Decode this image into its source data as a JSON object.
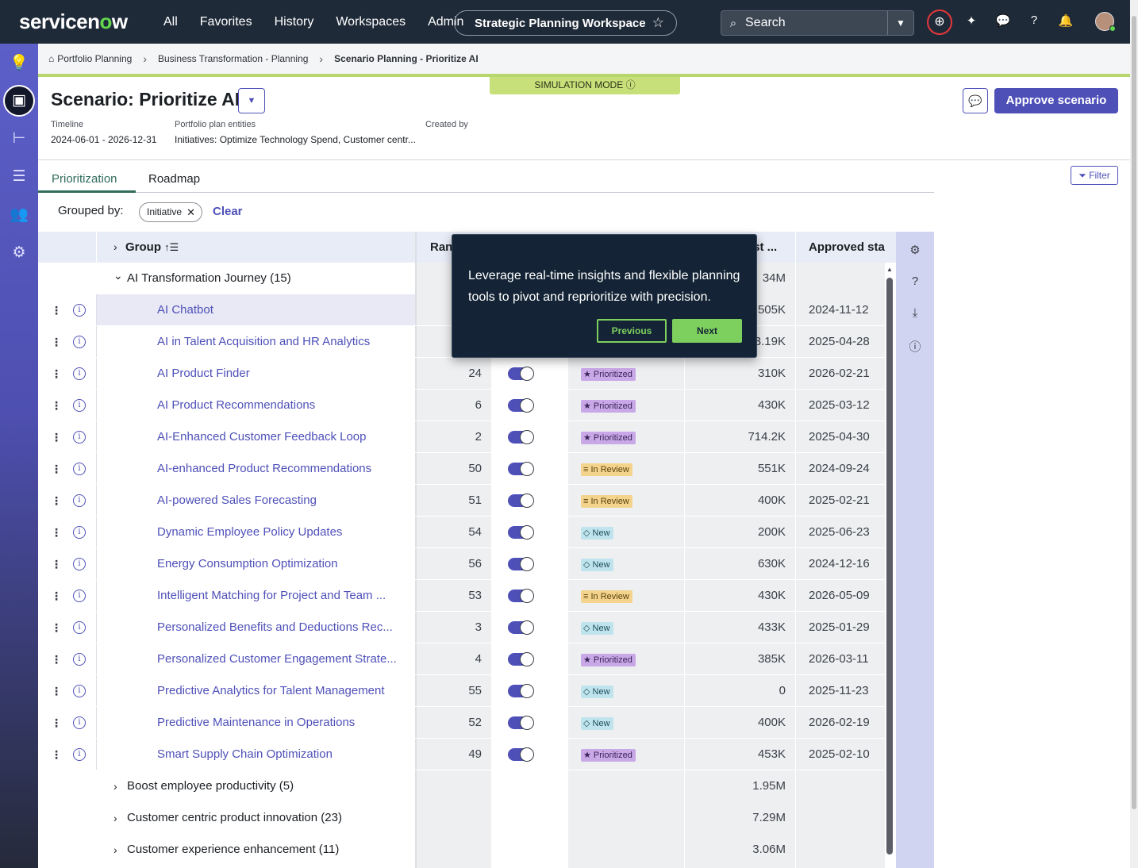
{
  "topnav": {
    "logo_text": "servicenow",
    "links": [
      "All",
      "Favorites",
      "History",
      "Workspaces",
      "Admin"
    ],
    "workspace_title": "Strategic Planning Workspace",
    "search_placeholder": "Search"
  },
  "breadcrumb": [
    "Portfolio Planning",
    "Business Transformation - Planning",
    "Scenario Planning - Prioritize AI"
  ],
  "simulation_mode": "SIMULATION MODE",
  "header": {
    "title": "Scenario: Prioritize AI",
    "timeline_label": "Timeline",
    "timeline_value": "2024-06-01 - 2026-12-31",
    "entities_label": "Portfolio plan entities",
    "entities_value": "Initiatives: Optimize Technology Spend, Customer centr...",
    "created_by_label": "Created by",
    "approve_label": "Approve scenario"
  },
  "tabs": [
    "Prioritization",
    "Roadmap"
  ],
  "filter_label": "Filter",
  "grouping": {
    "label": "Grouped by:",
    "chip": "Initiative",
    "clear": "Clear"
  },
  "columns": {
    "group": "Group",
    "rank": "Ran",
    "cost": "ost ...",
    "approved": "Approved sta"
  },
  "group_open": {
    "name": "AI Transformation Journey (15)",
    "cost": "34M"
  },
  "rows": [
    {
      "name": "AI Chatbot",
      "rank": "",
      "status": "",
      "cost": "505K",
      "approved": "2024-11-12"
    },
    {
      "name": "AI in Talent Acquisition and HR Analytics",
      "rank": "",
      "status": "",
      "cost": "3.19K",
      "approved": "2025-04-28"
    },
    {
      "name": "AI Product Finder",
      "rank": "24",
      "status": "Prioritized",
      "cost": "310K",
      "approved": "2026-02-21"
    },
    {
      "name": "AI Product Recommendations",
      "rank": "6",
      "status": "Prioritized",
      "cost": "430K",
      "approved": "2025-03-12"
    },
    {
      "name": "AI-Enhanced Customer Feedback Loop",
      "rank": "2",
      "status": "Prioritized",
      "cost": "714.2K",
      "approved": "2025-04-30"
    },
    {
      "name": "AI-enhanced Product Recommendations",
      "rank": "50",
      "status": "In Review",
      "cost": "551K",
      "approved": "2024-09-24"
    },
    {
      "name": "AI-powered Sales Forecasting",
      "rank": "51",
      "status": "In Review",
      "cost": "400K",
      "approved": "2025-02-21"
    },
    {
      "name": "Dynamic Employee Policy Updates",
      "rank": "54",
      "status": "New",
      "cost": "200K",
      "approved": "2025-06-23"
    },
    {
      "name": "Energy Consumption Optimization",
      "rank": "56",
      "status": "New",
      "cost": "630K",
      "approved": "2024-12-16"
    },
    {
      "name": "Intelligent Matching for Project and Team ...",
      "rank": "53",
      "status": "In Review",
      "cost": "430K",
      "approved": "2026-05-09"
    },
    {
      "name": "Personalized Benefits and Deductions Rec...",
      "rank": "3",
      "status": "New",
      "cost": "433K",
      "approved": "2025-01-29"
    },
    {
      "name": "Personalized Customer Engagement Strate...",
      "rank": "4",
      "status": "Prioritized",
      "cost": "385K",
      "approved": "2026-03-11"
    },
    {
      "name": "Predictive Analytics for Talent Management",
      "rank": "55",
      "status": "New",
      "cost": "0",
      "approved": "2025-11-23"
    },
    {
      "name": "Predictive Maintenance in Operations",
      "rank": "52",
      "status": "New",
      "cost": "400K",
      "approved": "2026-02-19"
    },
    {
      "name": "Smart Supply Chain Optimization",
      "rank": "49",
      "status": "Prioritized",
      "cost": "453K",
      "approved": "2025-02-10"
    }
  ],
  "collapsed_groups": [
    {
      "name": "Boost employee productivity (5)",
      "cost": "1.95M"
    },
    {
      "name": "Customer centric product innovation (23)",
      "cost": "7.29M"
    },
    {
      "name": "Customer experience enhancement (11)",
      "cost": "3.06M"
    }
  ],
  "tour": {
    "text": "Leverage real-time insights and flexible planning tools to pivot and reprioritize with precision.",
    "previous": "Previous",
    "next": "Next"
  }
}
